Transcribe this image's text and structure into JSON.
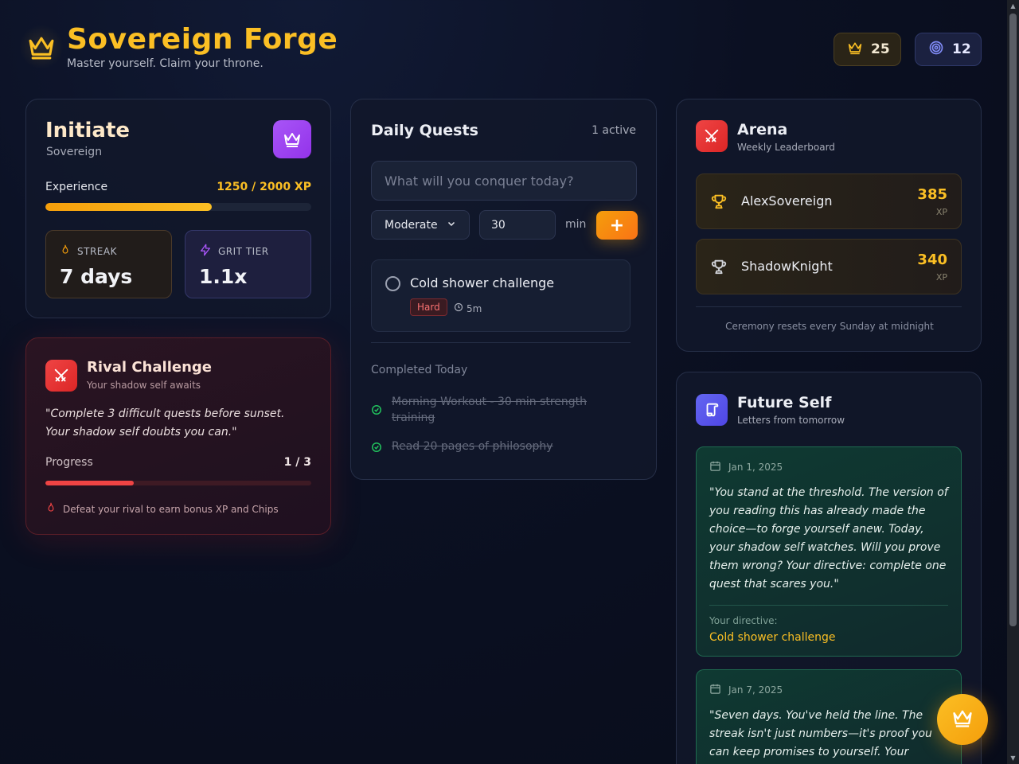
{
  "header": {
    "title": "Sovereign Forge",
    "subtitle": "Master yourself. Claim your throne.",
    "crowns": "25",
    "chips": "12"
  },
  "rank": {
    "title": "Initiate",
    "subtitle": "Sovereign",
    "xp_label": "Experience",
    "xp_text": "1250 / 2000 XP",
    "xp_fraction": 0.625,
    "streak_label": "STREAK",
    "streak_value": "7 days",
    "grit_label": "GRIT TIER",
    "grit_value": "1.1x"
  },
  "rival": {
    "title": "Rival Challenge",
    "subtitle": "Your shadow self awaits",
    "quote": "\"Complete 3 difficult quests before sunset. Your shadow self doubts you can.\"",
    "progress_label": "Progress",
    "progress_text": "1 / 3",
    "progress_fraction": 0.333,
    "footer": "Defeat your rival to earn bonus XP and Chips"
  },
  "quests": {
    "title": "Daily Quests",
    "active_count": "1 active",
    "input_placeholder": "What will you conquer today?",
    "difficulty_selected": "Moderate",
    "minutes_value": "30",
    "minutes_unit": "min",
    "add_label": "+",
    "active": [
      {
        "title": "Cold shower challenge",
        "difficulty": "Hard",
        "time": "5m"
      }
    ],
    "completed_label": "Completed Today",
    "completed": [
      "Morning Workout - 30 min strength training",
      "Read 20 pages of philosophy"
    ]
  },
  "arena": {
    "title": "Arena",
    "subtitle": "Weekly Leaderboard",
    "leaders": [
      {
        "name": "AlexSovereign",
        "xp": "385",
        "unit": "XP"
      },
      {
        "name": "ShadowKnight",
        "xp": "340",
        "unit": "XP"
      }
    ],
    "footer": "Ceremony resets every Sunday at midnight"
  },
  "future": {
    "title": "Future Self",
    "subtitle": "Letters from tomorrow",
    "letters": [
      {
        "date": "Jan 1, 2025",
        "body": "\"You stand at the threshold. The version of you reading this has already made the choice—to forge yourself anew. Today, your shadow self watches. Will you prove them wrong? Your directive: complete one quest that scares you.\"",
        "directive_label": "Your directive:",
        "directive": "Cold shower challenge"
      },
      {
        "date": "Jan 7, 2025",
        "body": "\"Seven days. You've held the line. The streak isn't just numbers—it's proof you can keep promises to yourself. Your rival"
      }
    ]
  },
  "colors": {
    "gold": "#fbbf24",
    "purple": "#a855f7",
    "red": "#ef4444",
    "indigo": "#6366f1",
    "green_border": "#1f6a50"
  }
}
